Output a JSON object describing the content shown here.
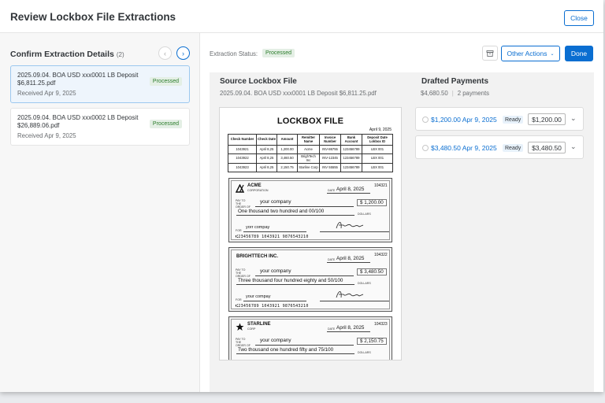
{
  "header": {
    "title": "Review Lockbox File Extractions",
    "close_label": "Close"
  },
  "left": {
    "title": "Confirm Extraction Details",
    "count": "(2)",
    "items": [
      {
        "name": "2025.09.04. BOA USD xxx0001 LB Deposit $6,811.25.pdf",
        "date": "Received Apr 9, 2025",
        "status": "Processed"
      },
      {
        "name": "2025.09.04. BOA USD xxx0002 LB Deposit $26,889.06.pdf",
        "date": "Received Apr 9, 2025",
        "status": "Processed"
      }
    ]
  },
  "toolbar": {
    "status_label": "Extraction Status:",
    "status_value": "Processed",
    "other_actions": "Other Actions",
    "done": "Done"
  },
  "source": {
    "title": "Source Lockbox File",
    "filename": "2025.09.04. BOA USD xxx0001 LB Deposit $6,811.25.pdf"
  },
  "lockbox": {
    "title": "LOCKBOX FILE",
    "date": "April 9, 2025",
    "headers": [
      "Check Number",
      "Check Date",
      "Amount",
      "Remitter Name",
      "Invoice Number",
      "Bank Account",
      "Deposit Date Lokbox ID"
    ],
    "rows": [
      [
        "1043921",
        "April 8,25",
        "1,200.00",
        "Acme",
        "INV-86755",
        "123456789",
        "LBX 001"
      ],
      [
        "1043922",
        "April 8,25",
        "3,460.50",
        "BrighTech Inc",
        "INV-12345",
        "123456789",
        "LBX 001"
      ],
      [
        "1043923",
        "April 8,25",
        "2,150.75",
        "Starline Corp",
        "INV 55555",
        "123456789",
        "LBX 001"
      ]
    ]
  },
  "checks": [
    {
      "company": "ACME",
      "company_sub": "CORPORATION",
      "number": "104321",
      "date": "April 8, 2025",
      "payee": "your company",
      "amount": "$ 1,200.00",
      "words": "One thousand two hundred and 00/100",
      "memo": "yorr compay",
      "micr": "⑆23456789  1043921  9876543210"
    },
    {
      "company": "BRIGHTTECH INC.",
      "company_sub": "",
      "number": "104322",
      "date": "April 8, 2025",
      "payee": "your company",
      "amount": "$ 3,480.50",
      "words": "Three thousand four hundred eighty and 50/100",
      "memo": "your compay",
      "micr": "⑆23456789  1043921  9876543210"
    },
    {
      "company": "STARLINE",
      "company_sub": "CORP",
      "number": "104323",
      "date": "April 8, 2025",
      "payee": "your company",
      "amount": "$ 2,150.75",
      "words": "Two thousand one hundred fifty and 75/100",
      "memo": "",
      "micr": ""
    }
  ],
  "check_labels": {
    "date": "DATE",
    "pay_to": "PAY TO THE ORDER OF",
    "dollars": "DOLLARS",
    "for": "FOR"
  },
  "payments": {
    "title": "Drafted Payments",
    "total": "$4,680.50",
    "count": "2 payments",
    "items": [
      {
        "amount": "$1,200.00",
        "date": "Apr 9, 2025",
        "status": "Ready",
        "value": "$1,200.00"
      },
      {
        "amount": "$3,480.50",
        "date": "Apr 9, 2025",
        "status": "Ready",
        "value": "$3,480.50"
      }
    ]
  }
}
